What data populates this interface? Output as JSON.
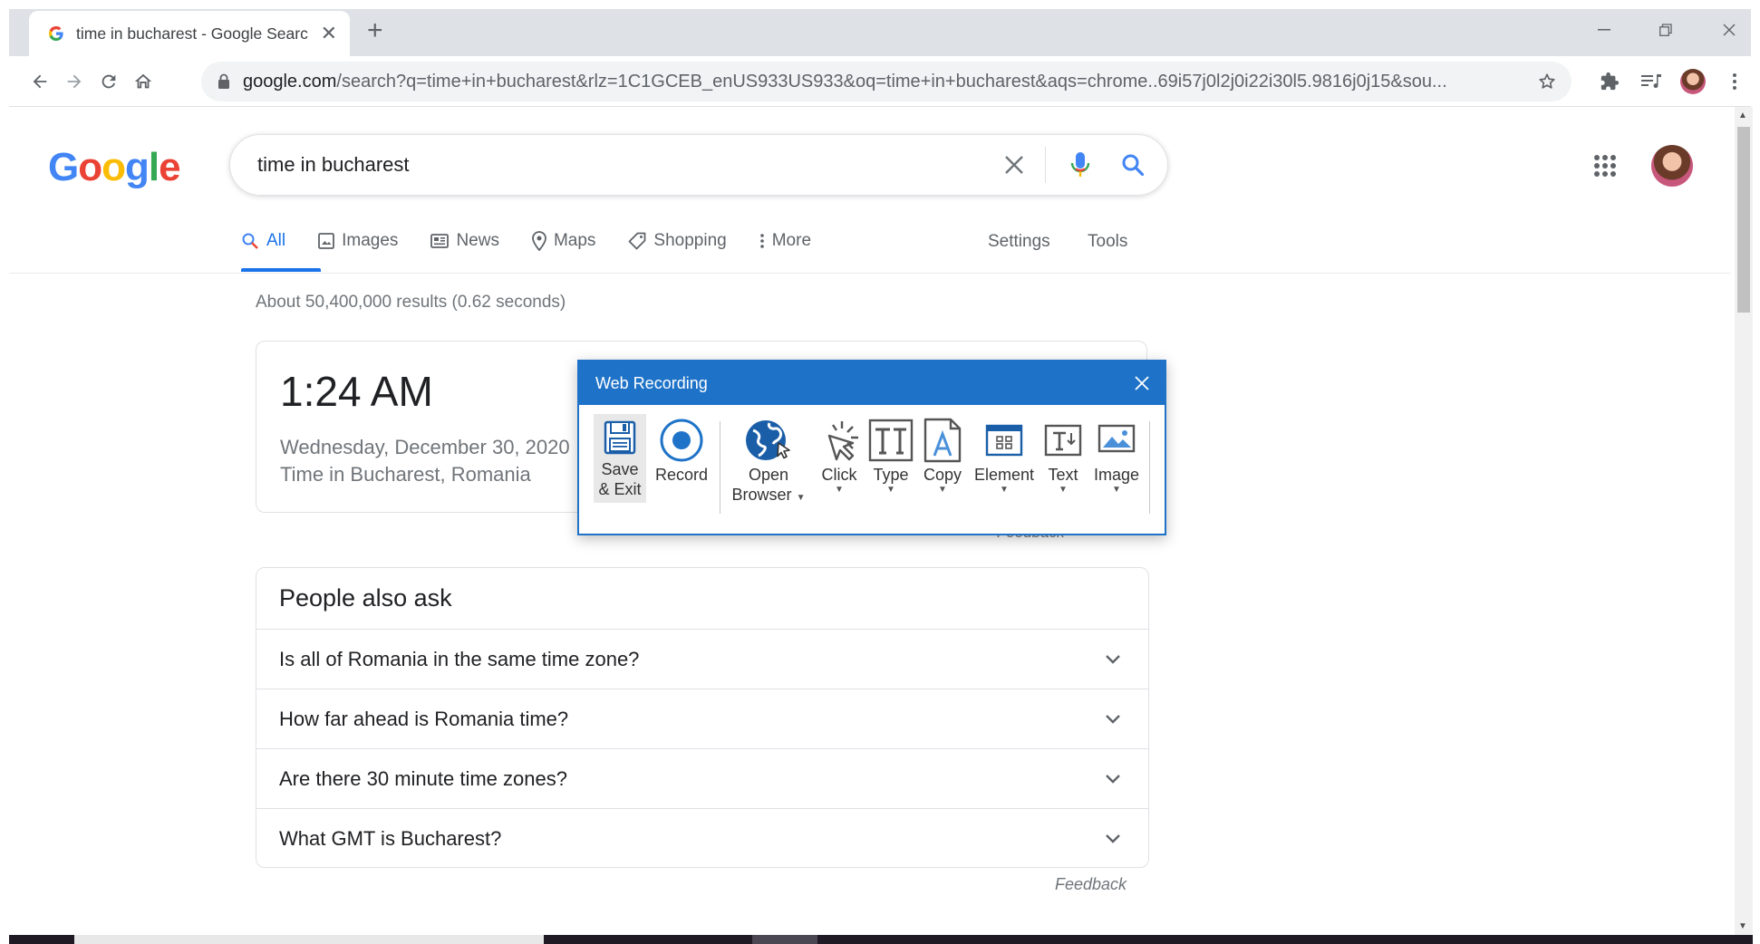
{
  "browser": {
    "tab_title": "time in bucharest - Google Searc",
    "url_host": "google.com",
    "url_path": "/search?q=time+in+bucharest&rlz=1C1GCEB_enUS933US933&oq=time+in+bucharest&aqs=chrome..69i57j0l2j0i22i30l5.9816j0j15&sou..."
  },
  "search": {
    "query": "time in bucharest"
  },
  "nav_tabs": [
    {
      "label": "All",
      "icon": "search-icon",
      "active": true
    },
    {
      "label": "Images",
      "icon": "image-icon"
    },
    {
      "label": "News",
      "icon": "news-icon"
    },
    {
      "label": "Maps",
      "icon": "map-pin-icon"
    },
    {
      "label": "Shopping",
      "icon": "tag-icon"
    },
    {
      "label": "More",
      "icon": "more-vert-icon"
    }
  ],
  "nav_right": {
    "settings": "Settings",
    "tools": "Tools"
  },
  "results_stats": "About 50,400,000 results (0.62 seconds)",
  "time_card": {
    "time": "1:24 AM",
    "date": "Wednesday, December 30, 2020",
    "place": "Time in Bucharest, Romania"
  },
  "feedback": "Feedback",
  "people_also_ask": {
    "title": "People also ask",
    "questions": [
      "Is all of Romania in the same time zone?",
      "How far ahead is Romania time?",
      "Are there 30 minute time zones?",
      "What GMT is Bucharest?"
    ]
  },
  "recorder": {
    "title": "Web Recording",
    "tools": {
      "save_exit": {
        "line1": "Save",
        "line2": "& Exit"
      },
      "record": "Record",
      "open_browser": {
        "line1": "Open",
        "line2": "Browser"
      },
      "click": "Click",
      "type": "Type",
      "copy": "Copy",
      "element": "Element",
      "text": "Text",
      "image": "Image"
    }
  },
  "colors": {
    "google_blue": "#4285f4",
    "google_red": "#ea4335",
    "google_yellow": "#fbbc05",
    "google_green": "#34a853",
    "link_active": "#1a73e8",
    "recorder_header": "#1e73c8"
  }
}
